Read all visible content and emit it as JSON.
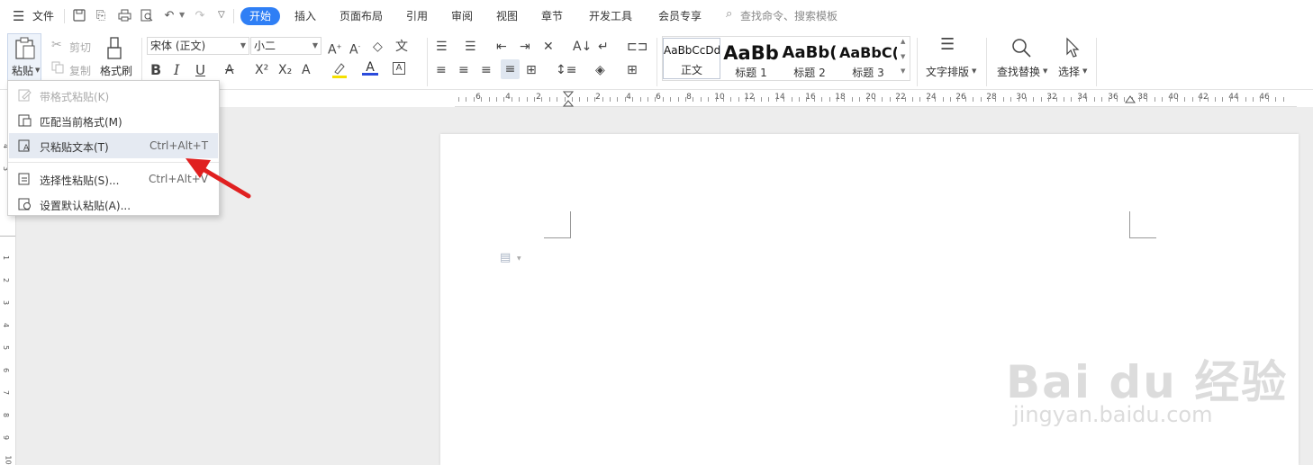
{
  "menubar": {
    "file_label": "文件",
    "tabs": [
      "开始",
      "插入",
      "页面布局",
      "引用",
      "审阅",
      "视图",
      "章节",
      "开发工具",
      "会员专享"
    ],
    "search_placeholder": "查找命令、搜索模板"
  },
  "ribbon": {
    "paste": "粘贴",
    "cut": "剪切",
    "copy": "复制",
    "format_painter": "格式刷",
    "font_name": "宋体 (正文)",
    "font_size": "小二",
    "styles": [
      {
        "preview": "AaBbCcDd",
        "label": "正文"
      },
      {
        "preview": "AaBb",
        "label": "标题 1"
      },
      {
        "preview": "AaBb(",
        "label": "标题 2"
      },
      {
        "preview": "AaBbC(",
        "label": "标题 3"
      }
    ],
    "text_layout": "文字排版",
    "find_replace": "查找替换",
    "select": "选择"
  },
  "paste_menu": {
    "items": [
      {
        "label": "带格式粘贴(K)",
        "shortcut": ""
      },
      {
        "label": "匹配当前格式(M)",
        "shortcut": ""
      },
      {
        "label": "只粘贴文本(T)",
        "shortcut": "Ctrl+Alt+T"
      },
      {
        "label": "选择性粘贴(S)...",
        "shortcut": "Ctrl+Alt+V"
      },
      {
        "label": "设置默认粘贴(A)...",
        "shortcut": ""
      }
    ]
  },
  "ruler": {
    "ticks": [
      "6",
      "4",
      "2",
      "2",
      "4",
      "6",
      "8",
      "10",
      "12",
      "14",
      "16",
      "18",
      "20",
      "22",
      "24",
      "26",
      "28",
      "30",
      "32",
      "34",
      "36",
      "38",
      "40",
      "42",
      "44",
      "46"
    ],
    "vticks": [
      "4",
      "3",
      "1",
      "2",
      "3",
      "4",
      "5",
      "6",
      "7",
      "8",
      "9",
      "10"
    ]
  },
  "watermark": {
    "brand": "Bai du 经验",
    "url": "jingyan.baidu.com"
  },
  "colors": {
    "accent": "#2f7ff5",
    "arrow": "#e02020",
    "font_color": "#2b4bdc",
    "highlight": "#f5e000"
  }
}
